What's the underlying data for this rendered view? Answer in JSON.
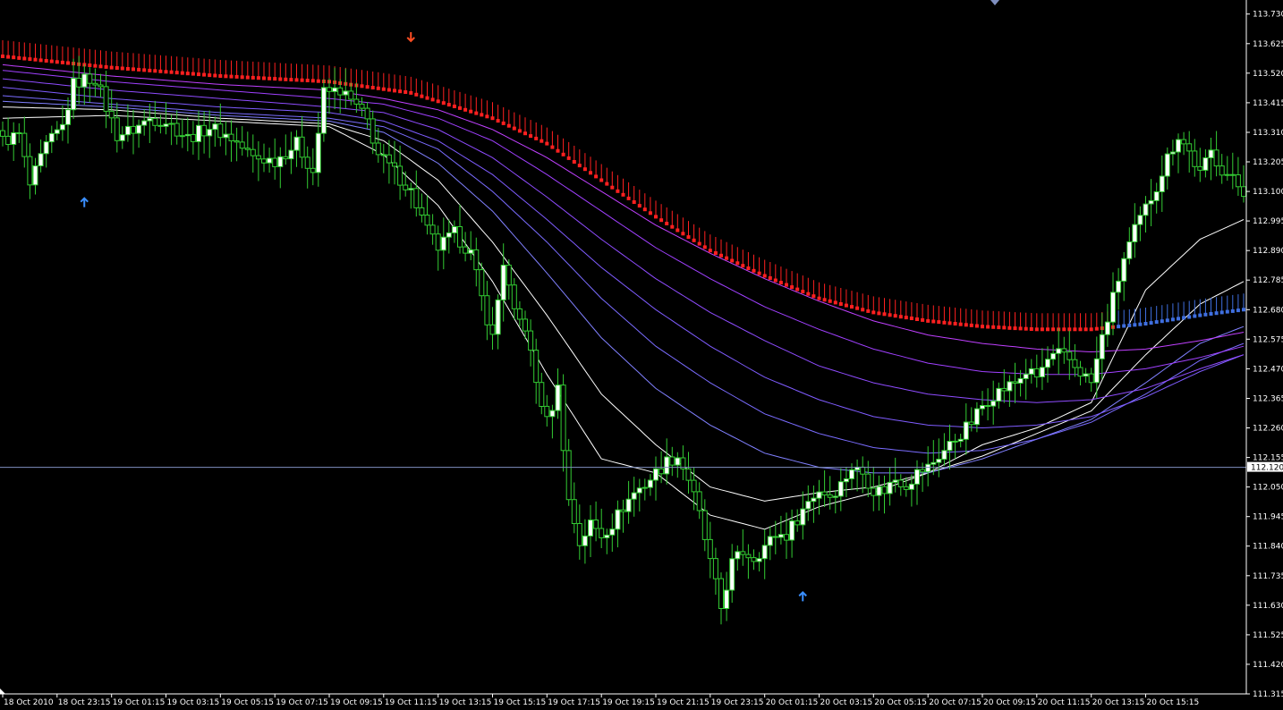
{
  "chart_data": {
    "type": "candlestick",
    "instrument": "",
    "colors": {
      "background": "#000000",
      "bull_body": "#ffffff",
      "bear_body": "#000000",
      "candle_outline": "#33cc33",
      "signal_band": "#ff2020",
      "signal_band_alt": "#3f6fe0",
      "ma_bands": [
        "#ffffff",
        "#ffffff",
        "#8080ff",
        "#7a6cff",
        "#7f5cff",
        "#8f4cff",
        "#a040ff",
        "#c040ff"
      ],
      "axis": "#ffffff",
      "current_price_line": "#7f8fbf",
      "price_tag_bg": "#ffffff",
      "price_tag_text": "#000000",
      "arrow_up": "#3a8fff",
      "arrow_down": "#ff4d22"
    },
    "y_axis": {
      "ylim": [
        111.315,
        113.78
      ],
      "ticks": [
        "113.730",
        "113.625",
        "113.520",
        "113.415",
        "113.310",
        "113.205",
        "113.100",
        "112.995",
        "112.890",
        "112.785",
        "112.680",
        "112.575",
        "112.470",
        "112.365",
        "112.260",
        "112.155",
        "112.050",
        "111.945",
        "111.840",
        "111.735",
        "111.630",
        "111.525",
        "111.420",
        "111.315"
      ],
      "current_price": "112.120",
      "current_value": 112.12
    },
    "x_axis": {
      "bars": 229,
      "labels": [
        {
          "text": "18 Oct 2010",
          "bar": 0
        },
        {
          "text": "18 Oct 23:15",
          "bar": 10
        },
        {
          "text": "19 Oct 01:15",
          "bar": 20
        },
        {
          "text": "19 Oct 03:15",
          "bar": 30
        },
        {
          "text": "19 Oct 05:15",
          "bar": 40
        },
        {
          "text": "19 Oct 07:15",
          "bar": 50
        },
        {
          "text": "19 Oct 09:15",
          "bar": 60
        },
        {
          "text": "19 Oct 11:15",
          "bar": 70
        },
        {
          "text": "19 Oct 13:15",
          "bar": 80
        },
        {
          "text": "19 Oct 15:15",
          "bar": 90
        },
        {
          "text": "19 Oct 17:15",
          "bar": 100
        },
        {
          "text": "19 Oct 19:15",
          "bar": 110
        },
        {
          "text": "19 Oct 21:15",
          "bar": 120
        },
        {
          "text": "19 Oct 23:15",
          "bar": 130
        },
        {
          "text": "20 Oct 01:15",
          "bar": 140
        },
        {
          "text": "20 Oct 03:15",
          "bar": 150
        },
        {
          "text": "20 Oct 05:15",
          "bar": 160
        },
        {
          "text": "20 Oct 07:15",
          "bar": 170
        },
        {
          "text": "20 Oct 09:15",
          "bar": 180
        },
        {
          "text": "20 Oct 11:15",
          "bar": 190
        },
        {
          "text": "20 Oct 13:15",
          "bar": 200
        },
        {
          "text": "20 Oct 15:15",
          "bar": 210
        }
      ]
    },
    "close_anchors": [
      [
        0,
        113.28
      ],
      [
        3,
        113.3
      ],
      [
        5,
        113.12
      ],
      [
        8,
        113.26
      ],
      [
        11,
        113.33
      ],
      [
        13,
        113.48
      ],
      [
        15,
        113.5
      ],
      [
        17,
        113.5
      ],
      [
        19,
        113.4
      ],
      [
        21,
        113.3
      ],
      [
        24,
        113.32
      ],
      [
        27,
        113.36
      ],
      [
        30,
        113.35
      ],
      [
        34,
        113.29
      ],
      [
        38,
        113.33
      ],
      [
        42,
        113.29
      ],
      [
        46,
        113.22
      ],
      [
        50,
        113.21
      ],
      [
        54,
        113.27
      ],
      [
        57,
        113.17
      ],
      [
        59,
        113.45
      ],
      [
        62,
        113.46
      ],
      [
        65,
        113.4
      ],
      [
        67,
        113.35
      ],
      [
        69,
        113.23
      ],
      [
        72,
        113.17
      ],
      [
        75,
        113.1
      ],
      [
        78,
        112.96
      ],
      [
        80,
        112.9
      ],
      [
        83,
        112.95
      ],
      [
        86,
        112.88
      ],
      [
        88,
        112.72
      ],
      [
        90,
        112.58
      ],
      [
        92,
        112.85
      ],
      [
        94,
        112.66
      ],
      [
        96,
        112.62
      ],
      [
        98,
        112.42
      ],
      [
        100,
        112.28
      ],
      [
        102,
        112.4
      ],
      [
        104,
        112.0
      ],
      [
        106,
        111.85
      ],
      [
        108,
        111.92
      ],
      [
        110,
        111.88
      ],
      [
        112,
        111.92
      ],
      [
        114,
        111.98
      ],
      [
        116,
        112.03
      ],
      [
        118,
        112.06
      ],
      [
        120,
        112.1
      ],
      [
        122,
        112.14
      ],
      [
        124,
        112.16
      ],
      [
        126,
        112.08
      ],
      [
        128,
        111.95
      ],
      [
        130,
        111.78
      ],
      [
        132,
        111.62
      ],
      [
        134,
        111.78
      ],
      [
        136,
        111.82
      ],
      [
        138,
        111.8
      ],
      [
        140,
        111.84
      ],
      [
        142,
        111.88
      ],
      [
        144,
        111.88
      ],
      [
        146,
        111.94
      ],
      [
        148,
        112.0
      ],
      [
        150,
        112.04
      ],
      [
        152,
        112.02
      ],
      [
        154,
        112.06
      ],
      [
        156,
        112.12
      ],
      [
        158,
        112.1
      ],
      [
        160,
        112.04
      ],
      [
        162,
        112.04
      ],
      [
        164,
        112.08
      ],
      [
        166,
        112.06
      ],
      [
        168,
        112.1
      ],
      [
        170,
        112.12
      ],
      [
        172,
        112.16
      ],
      [
        174,
        112.2
      ],
      [
        176,
        112.24
      ],
      [
        178,
        112.28
      ],
      [
        180,
        112.34
      ],
      [
        182,
        112.38
      ],
      [
        184,
        112.4
      ],
      [
        186,
        112.42
      ],
      [
        188,
        112.46
      ],
      [
        190,
        112.44
      ],
      [
        192,
        112.5
      ],
      [
        194,
        112.52
      ],
      [
        196,
        112.5
      ],
      [
        198,
        112.46
      ],
      [
        200,
        112.42
      ],
      [
        202,
        112.58
      ],
      [
        204,
        112.72
      ],
      [
        206,
        112.86
      ],
      [
        208,
        112.96
      ],
      [
        210,
        113.04
      ],
      [
        212,
        113.12
      ],
      [
        214,
        113.22
      ],
      [
        216,
        113.3
      ],
      [
        218,
        113.24
      ],
      [
        220,
        113.16
      ],
      [
        222,
        113.24
      ],
      [
        224,
        113.18
      ],
      [
        226,
        113.14
      ],
      [
        228,
        113.1
      ]
    ],
    "signal_band": {
      "anchors": [
        [
          0,
          113.58
        ],
        [
          20,
          113.54
        ],
        [
          40,
          113.51
        ],
        [
          60,
          113.49
        ],
        [
          75,
          113.45
        ],
        [
          90,
          113.36
        ],
        [
          100,
          113.27
        ],
        [
          110,
          113.14
        ],
        [
          120,
          113.01
        ],
        [
          130,
          112.89
        ],
        [
          140,
          112.8
        ],
        [
          150,
          112.72
        ],
        [
          160,
          112.67
        ],
        [
          170,
          112.64
        ],
        [
          180,
          112.62
        ],
        [
          190,
          112.61
        ],
        [
          200,
          112.61
        ],
        [
          210,
          112.63
        ],
        [
          220,
          112.66
        ],
        [
          228,
          112.68
        ]
      ],
      "switch_bar": 205
    },
    "ma_bands": [
      {
        "anchors": [
          [
            0,
            113.36
          ],
          [
            20,
            113.37
          ],
          [
            40,
            113.35
          ],
          [
            60,
            113.33
          ],
          [
            70,
            113.23
          ],
          [
            80,
            113.05
          ],
          [
            90,
            112.78
          ],
          [
            100,
            112.45
          ],
          [
            110,
            112.15
          ],
          [
            120,
            112.1
          ],
          [
            130,
            111.95
          ],
          [
            140,
            111.9
          ],
          [
            150,
            111.98
          ],
          [
            160,
            112.03
          ],
          [
            170,
            112.1
          ],
          [
            180,
            112.2
          ],
          [
            190,
            112.26
          ],
          [
            200,
            112.35
          ],
          [
            210,
            112.75
          ],
          [
            220,
            112.93
          ],
          [
            228,
            113.0
          ]
        ]
      },
      {
        "anchors": [
          [
            0,
            113.4
          ],
          [
            20,
            113.39
          ],
          [
            40,
            113.36
          ],
          [
            60,
            113.34
          ],
          [
            70,
            113.28
          ],
          [
            80,
            113.14
          ],
          [
            90,
            112.92
          ],
          [
            100,
            112.66
          ],
          [
            110,
            112.38
          ],
          [
            120,
            112.2
          ],
          [
            130,
            112.05
          ],
          [
            140,
            112.0
          ],
          [
            150,
            112.03
          ],
          [
            160,
            112.05
          ],
          [
            170,
            112.1
          ],
          [
            180,
            112.16
          ],
          [
            190,
            112.24
          ],
          [
            200,
            112.32
          ],
          [
            210,
            112.52
          ],
          [
            220,
            112.7
          ],
          [
            228,
            112.78
          ]
        ]
      },
      {
        "anchors": [
          [
            0,
            113.42
          ],
          [
            20,
            113.4
          ],
          [
            40,
            113.37
          ],
          [
            60,
            113.35
          ],
          [
            70,
            113.31
          ],
          [
            80,
            113.2
          ],
          [
            90,
            113.03
          ],
          [
            100,
            112.81
          ],
          [
            110,
            112.58
          ],
          [
            120,
            112.4
          ],
          [
            130,
            112.27
          ],
          [
            140,
            112.17
          ],
          [
            150,
            112.12
          ],
          [
            160,
            112.1
          ],
          [
            170,
            112.1
          ],
          [
            180,
            112.15
          ],
          [
            190,
            112.22
          ],
          [
            200,
            112.29
          ],
          [
            210,
            112.42
          ],
          [
            220,
            112.56
          ],
          [
            228,
            112.62
          ]
        ]
      },
      {
        "anchors": [
          [
            0,
            113.44
          ],
          [
            20,
            113.41
          ],
          [
            40,
            113.38
          ],
          [
            60,
            113.36
          ],
          [
            70,
            113.33
          ],
          [
            80,
            113.25
          ],
          [
            90,
            113.1
          ],
          [
            100,
            112.92
          ],
          [
            110,
            112.72
          ],
          [
            120,
            112.55
          ],
          [
            130,
            112.42
          ],
          [
            140,
            112.31
          ],
          [
            150,
            112.24
          ],
          [
            160,
            112.19
          ],
          [
            170,
            112.17
          ],
          [
            180,
            112.18
          ],
          [
            190,
            112.22
          ],
          [
            200,
            112.28
          ],
          [
            210,
            112.38
          ],
          [
            220,
            112.5
          ],
          [
            228,
            112.56
          ]
        ]
      },
      {
        "anchors": [
          [
            0,
            113.47
          ],
          [
            20,
            113.43
          ],
          [
            40,
            113.4
          ],
          [
            60,
            113.38
          ],
          [
            70,
            113.35
          ],
          [
            80,
            113.28
          ],
          [
            90,
            113.16
          ],
          [
            100,
            113.0
          ],
          [
            110,
            112.83
          ],
          [
            120,
            112.68
          ],
          [
            130,
            112.55
          ],
          [
            140,
            112.44
          ],
          [
            150,
            112.36
          ],
          [
            160,
            112.3
          ],
          [
            170,
            112.27
          ],
          [
            180,
            112.26
          ],
          [
            190,
            112.27
          ],
          [
            200,
            112.3
          ],
          [
            210,
            112.37
          ],
          [
            220,
            112.46
          ],
          [
            228,
            112.52
          ]
        ]
      },
      {
        "anchors": [
          [
            0,
            113.5
          ],
          [
            20,
            113.46
          ],
          [
            40,
            113.43
          ],
          [
            60,
            113.4
          ],
          [
            70,
            113.38
          ],
          [
            80,
            113.32
          ],
          [
            90,
            113.22
          ],
          [
            100,
            113.08
          ],
          [
            110,
            112.93
          ],
          [
            120,
            112.79
          ],
          [
            130,
            112.67
          ],
          [
            140,
            112.57
          ],
          [
            150,
            112.48
          ],
          [
            160,
            112.42
          ],
          [
            170,
            112.38
          ],
          [
            180,
            112.36
          ],
          [
            190,
            112.35
          ],
          [
            200,
            112.36
          ],
          [
            210,
            112.4
          ],
          [
            220,
            112.47
          ],
          [
            228,
            112.52
          ]
        ]
      },
      {
        "anchors": [
          [
            0,
            113.53
          ],
          [
            20,
            113.49
          ],
          [
            40,
            113.46
          ],
          [
            60,
            113.43
          ],
          [
            70,
            113.41
          ],
          [
            80,
            113.36
          ],
          [
            90,
            113.28
          ],
          [
            100,
            113.16
          ],
          [
            110,
            113.03
          ],
          [
            120,
            112.9
          ],
          [
            130,
            112.79
          ],
          [
            140,
            112.69
          ],
          [
            150,
            112.61
          ],
          [
            160,
            112.54
          ],
          [
            170,
            112.49
          ],
          [
            180,
            112.46
          ],
          [
            190,
            112.45
          ],
          [
            200,
            112.45
          ],
          [
            210,
            112.47
          ],
          [
            220,
            112.51
          ],
          [
            228,
            112.55
          ]
        ]
      },
      {
        "anchors": [
          [
            0,
            113.55
          ],
          [
            20,
            113.51
          ],
          [
            40,
            113.48
          ],
          [
            60,
            113.46
          ],
          [
            70,
            113.43
          ],
          [
            80,
            113.39
          ],
          [
            90,
            113.32
          ],
          [
            100,
            113.22
          ],
          [
            110,
            113.1
          ],
          [
            120,
            112.98
          ],
          [
            130,
            112.88
          ],
          [
            140,
            112.79
          ],
          [
            150,
            112.71
          ],
          [
            160,
            112.64
          ],
          [
            170,
            112.59
          ],
          [
            180,
            112.56
          ],
          [
            190,
            112.54
          ],
          [
            200,
            112.53
          ],
          [
            210,
            112.54
          ],
          [
            220,
            112.57
          ],
          [
            228,
            112.6
          ]
        ]
      }
    ],
    "arrows": [
      {
        "type": "up",
        "bar": 15,
        "price": 113.06
      },
      {
        "type": "down",
        "bar": 75,
        "price": 113.65
      },
      {
        "type": "up",
        "bar": 147,
        "price": 111.66
      }
    ]
  }
}
